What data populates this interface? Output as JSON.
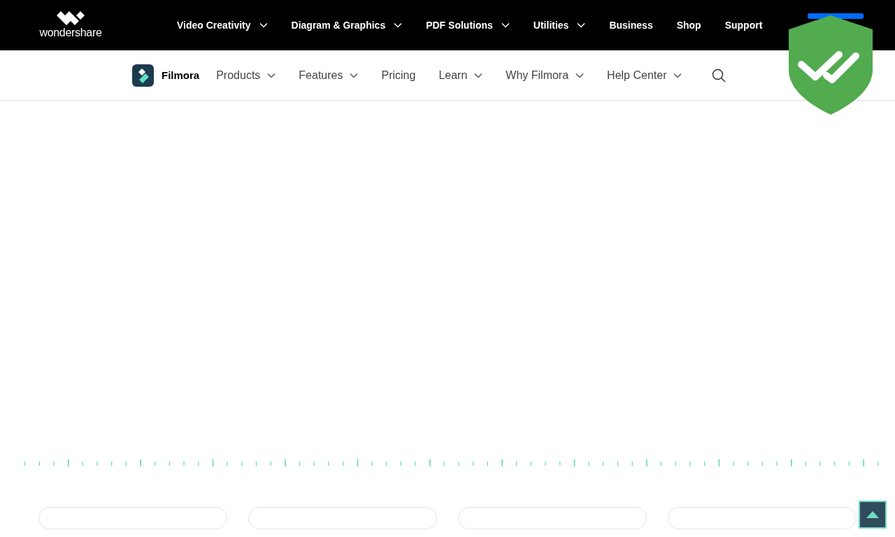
{
  "top_nav": {
    "logo_text": "wondershare",
    "items": [
      {
        "label": "Video Creativity",
        "dropdown": true
      },
      {
        "label": "Diagram & Graphics",
        "dropdown": true
      },
      {
        "label": "PDF Solutions",
        "dropdown": true
      },
      {
        "label": "Utilities",
        "dropdown": true
      },
      {
        "label": "Business",
        "dropdown": false
      },
      {
        "label": "Shop",
        "dropdown": false
      },
      {
        "label": "Support",
        "dropdown": false
      }
    ]
  },
  "sub_nav": {
    "brand": "Filmora",
    "items": [
      {
        "label": "Products",
        "dropdown": true
      },
      {
        "label": "Features",
        "dropdown": true
      },
      {
        "label": "Pricing",
        "dropdown": false
      },
      {
        "label": "Learn",
        "dropdown": true
      },
      {
        "label": "Why Filmora",
        "dropdown": true
      },
      {
        "label": "Help Center",
        "dropdown": true
      }
    ]
  }
}
